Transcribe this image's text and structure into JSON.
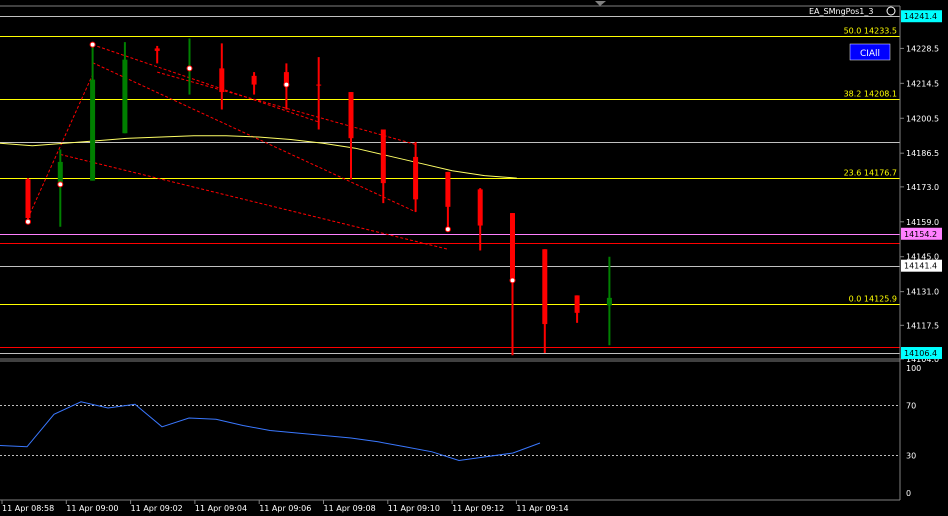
{
  "window": {
    "indicator_label": "EA_SMngPos1_3"
  },
  "chart_data": [
    {
      "type": "candlestick",
      "x_labels": [
        "11 Apr 08:58",
        "11 Apr 09:00",
        "11 Apr 09:02",
        "11 Apr 09:04",
        "11 Apr 09:06",
        "11 Apr 09:08",
        "11 Apr 09:10",
        "11 Apr 09:12",
        "11 Apr 09:14"
      ],
      "y_ticks": [
        14228.5,
        14214.5,
        14200.5,
        14186.5,
        14173.0,
        14159.0,
        14145.0,
        14131.0,
        14117.5,
        14104.0
      ],
      "ylim": [
        14104.0,
        14245.5
      ],
      "candles": [
        {
          "o": 14176.0,
          "h": 14176.5,
          "l": 14159.0,
          "c": 14160.5,
          "color": "#ff0000"
        },
        {
          "o": 14174.0,
          "h": 14188.0,
          "l": 14157.0,
          "c": 14183.0,
          "color": "#008000"
        },
        {
          "o": 14175.5,
          "h": 14230.0,
          "l": 14175.5,
          "c": 14216.0,
          "color": "#008000"
        },
        {
          "o": 14194.5,
          "h": 14231.0,
          "l": 14194.5,
          "c": 14224.0,
          "color": "#008000"
        },
        {
          "o": 14228.5,
          "h": 14229.5,
          "l": 14222.5,
          "c": 14227.5,
          "color": "#ff0000"
        },
        {
          "o": 14220.5,
          "h": 14232.5,
          "l": 14210.0,
          "c": 14221.0,
          "color": "#008000"
        },
        {
          "o": 14220.5,
          "h": 14230.5,
          "l": 14204.0,
          "c": 14211.0,
          "color": "#ff0000"
        },
        {
          "o": 14217.5,
          "h": 14219.0,
          "l": 14210.0,
          "c": 14214.0,
          "color": "#ff0000"
        },
        {
          "o": 14219.0,
          "h": 14222.5,
          "l": 14204.0,
          "c": 14214.0,
          "color": "#ff0000"
        },
        {
          "o": 14214.0,
          "h": 14225.0,
          "l": 14196.0,
          "c": 14214.0,
          "color": "#ff0000"
        },
        {
          "o": 14211.0,
          "h": 14211.0,
          "l": 14176.0,
          "c": 14192.5,
          "color": "#ff0000"
        },
        {
          "o": 14196.0,
          "h": 14196.0,
          "l": 14166.5,
          "c": 14174.5,
          "color": "#ff0000"
        },
        {
          "o": 14185.0,
          "h": 14191.0,
          "l": 14163.0,
          "c": 14168.0,
          "color": "#ff0000"
        },
        {
          "o": 14179.0,
          "h": 14179.0,
          "l": 14156.0,
          "c": 14165.0,
          "color": "#ff0000"
        },
        {
          "o": 14172.0,
          "h": 14172.5,
          "l": 14147.5,
          "c": 14157.5,
          "color": "#ff0000"
        },
        {
          "o": 14162.5,
          "h": 14162.5,
          "l": 14105.5,
          "c": 14135.5,
          "color": "#ff0000"
        },
        {
          "o": 14148.0,
          "h": 14148.0,
          "l": 14106.4,
          "c": 14118.0,
          "color": "#ff0000"
        },
        {
          "o": 14129.5,
          "h": 14129.5,
          "l": 14118.5,
          "c": 14122.5,
          "color": "#ff0000"
        },
        {
          "o": 14125.5,
          "h": 14145.0,
          "l": 14109.5,
          "c": 14128.5,
          "color": "#008000"
        }
      ],
      "moving_average": {
        "color": "#ffff66",
        "values": [
          14190.5,
          14189.5,
          14190.5,
          14191.5,
          14192.5,
          14193.0,
          14193.5,
          14193.5,
          14193.0,
          14192.0,
          14190.5,
          14188.5,
          14185.5,
          14182.5,
          14179.5,
          14177.5,
          14176.5
        ]
      },
      "levels": [
        {
          "value": 14241.4,
          "label": "",
          "price_box": "14241.4",
          "color": "#c0c0c0",
          "box_bg": "#00ffff",
          "style": "solid"
        },
        {
          "value": 14233.5,
          "label": "50.0 14233.5",
          "price_box": "",
          "color": "#ffff00",
          "style": "solid"
        },
        {
          "value": 14208.1,
          "label": "38.2 14208.1",
          "price_box": "",
          "color": "#ffff00",
          "style": "solid"
        },
        {
          "value": 14191.0,
          "label": "",
          "price_box": "",
          "color": "#c0c0c0",
          "style": "solid"
        },
        {
          "value": 14176.7,
          "label": "23.6 14176.7",
          "price_box": "",
          "color": "#ffff00",
          "style": "solid"
        },
        {
          "value": 14154.2,
          "label": "",
          "price_box": "14154.2",
          "color": "#ff80ff",
          "box_bg": "#ff80ff",
          "style": "solid"
        },
        {
          "value": 14150.5,
          "label": "",
          "price_box": "",
          "color": "#ff0000",
          "style": "solid"
        },
        {
          "value": 14141.4,
          "label": "",
          "price_box": "14141.4",
          "color": "#c0c0c0",
          "box_bg": "#ffffff",
          "style": "solid"
        },
        {
          "value": 14125.9,
          "label": "0.0 14125.9",
          "price_box": "",
          "color": "#ffff00",
          "style": "solid"
        },
        {
          "value": 14109.0,
          "label": "",
          "price_box": "",
          "color": "#ff0000",
          "style": "solid"
        },
        {
          "value": 14106.4,
          "label": "",
          "price_box": "14106.4",
          "color": "#c0c0c0",
          "box_bg": "#00ffff",
          "style": "solid"
        }
      ],
      "button_label": "CIAll"
    },
    {
      "type": "line",
      "y_ticks": [
        100,
        70,
        30,
        0
      ],
      "ylim": [
        0,
        100
      ],
      "levels": [
        70,
        30
      ],
      "series": [
        {
          "color": "#3a78ff",
          "values": [
            38,
            37,
            63,
            73,
            68,
            71,
            53,
            60,
            59,
            54,
            50,
            48,
            46,
            44,
            41,
            37,
            33,
            26,
            29,
            32,
            40
          ]
        }
      ]
    }
  ]
}
